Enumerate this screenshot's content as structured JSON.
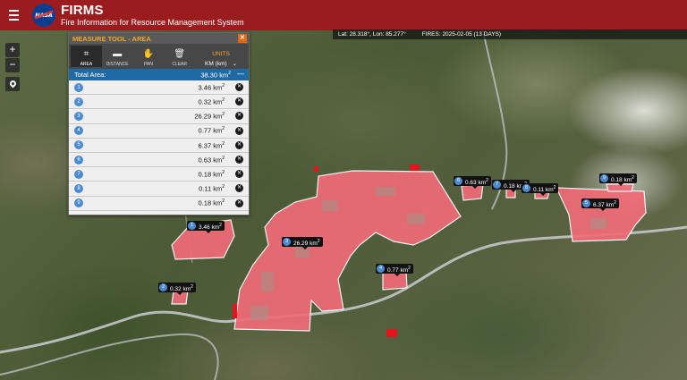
{
  "header": {
    "title": "FIRMS",
    "subtitle": "Fire Information for Resource Management System",
    "logo_text": "NASA"
  },
  "status_bar": {
    "coords": "Lat: 28.318°, Lon: 85.277°",
    "fires": "FIRES: 2025-02-05 (13 DAYS)"
  },
  "map_controls": {
    "zoom_in": "+",
    "zoom_out": "−"
  },
  "measure_tool": {
    "title": "MEASURE TOOL - AREA",
    "close": "✕",
    "tools": [
      {
        "label": "AREA",
        "icon": "⌗"
      },
      {
        "label": "DISTANCE",
        "icon": "▬"
      },
      {
        "label": "PAN",
        "icon": "✋"
      },
      {
        "label": "CLEAR",
        "icon": "🗑"
      }
    ],
    "units_label": "UNITS",
    "units_value": "KM (km)",
    "units_arrow": "⌄",
    "total_label": "Total Area:",
    "total_value": "38.30 km",
    "total_unit_sup": "2",
    "collapse": "—",
    "rows": [
      {
        "n": "1",
        "value": "3.46 km"
      },
      {
        "n": "2",
        "value": "0.32 km"
      },
      {
        "n": "3",
        "value": "26.29 km"
      },
      {
        "n": "4",
        "value": "0.77 km"
      },
      {
        "n": "5",
        "value": "6.37 km"
      },
      {
        "n": "6",
        "value": "0.63 km"
      },
      {
        "n": "7",
        "value": "0.18 km"
      },
      {
        "n": "8",
        "value": "0.11 km"
      },
      {
        "n": "9",
        "value": "0.18 km"
      }
    ],
    "sup": "2",
    "delete_icon": "✕"
  },
  "map_labels": [
    {
      "n": "1",
      "text": "3.46 km"
    },
    {
      "n": "2",
      "text": "0.32 km"
    },
    {
      "n": "3",
      "text": "26.29 km"
    },
    {
      "n": "4",
      "text": "0.77 km"
    },
    {
      "n": "5",
      "text": "6.37 km"
    },
    {
      "n": "6",
      "text": "0.63 km"
    },
    {
      "n": "7",
      "text": "0.18 km"
    },
    {
      "n": "8",
      "text": "0.11 km"
    },
    {
      "n": "9",
      "text": "0.18 km"
    }
  ],
  "colors": {
    "header": "#9b1c1f",
    "area_fill": "#f06b78",
    "fire_pixel": "#e3141e",
    "accent": "#f5a623",
    "total_bar": "#1f6aa5"
  }
}
